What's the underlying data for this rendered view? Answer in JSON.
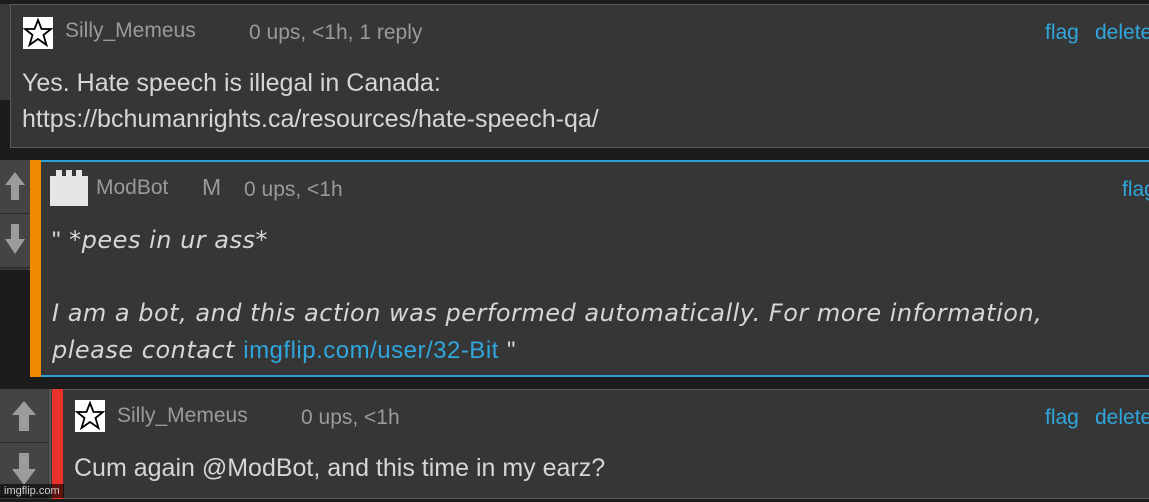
{
  "comment1": {
    "author": "Silly_Memeus",
    "meta": "0 ups, <1h, 1 reply",
    "flag_label": "flag",
    "delete_label": "delete",
    "body_line1": "Yes. Hate speech is illegal in Canada:",
    "body_line2": "https://bchumanrights.ca/resources/hate-speech-qa/"
  },
  "comment2": {
    "author": "ModBot",
    "badge": "M",
    "meta": "0 ups, <1h",
    "flag_label": "flag",
    "body_line1_quote": "\"",
    "body_line1": "*pees in ur ass*",
    "body_line2": "I am a bot, and this action was performed automatically. For more information,",
    "body_line3": "please contact",
    "body_link": "imgflip.com/user/32-Bit",
    "body_end_quote": "\""
  },
  "comment3": {
    "author": "Silly_Memeus",
    "meta": "0 ups, <1h",
    "flag_label": "flag",
    "delete_label": "delete",
    "body": "Cum again @ModBot, and this time in my earz?"
  },
  "watermark": "imgflip.com",
  "colors": {
    "link": "#30a6dd",
    "bot_accent": "#f08a00",
    "bot_border": "#2aa0d8",
    "user_accent": "#e8332c"
  },
  "icons": {
    "upvote": "arrow-up-icon",
    "downvote": "arrow-down-icon",
    "star": "star-icon",
    "bot_avatar": "castle-icon"
  }
}
